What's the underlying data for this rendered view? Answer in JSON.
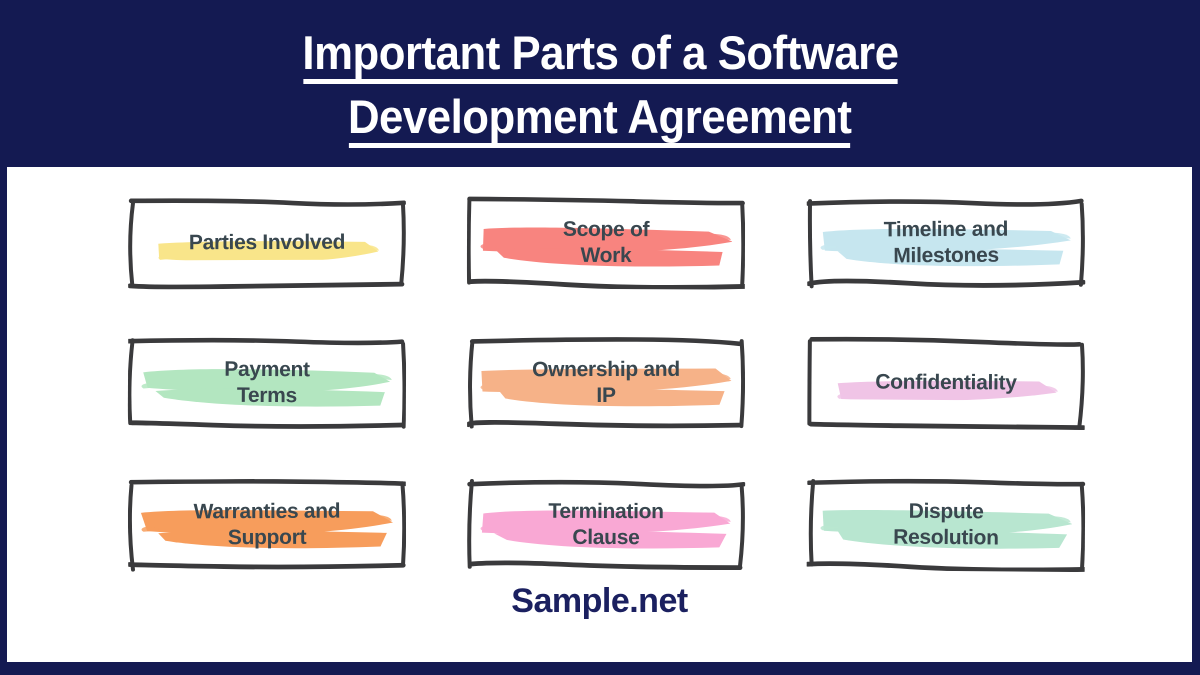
{
  "header": {
    "title_line_1": "Important Parts of a Software",
    "title_line_2": "Development Agreement",
    "background_color": "#141a52",
    "text_color": "#ffffff"
  },
  "canvas": {
    "background_color": "#ffffff"
  },
  "cards": [
    {
      "label": "Parties Involved",
      "highlight_color": "#f9e58a",
      "row": 1,
      "col": 1,
      "lines": 1
    },
    {
      "label": "Scope of\nWork",
      "highlight_color": "#f8847f",
      "row": 1,
      "col": 2,
      "lines": 2
    },
    {
      "label": "Timeline and\nMilestones",
      "highlight_color": "#c6e6ef",
      "row": 1,
      "col": 3,
      "lines": 2
    },
    {
      "label": "Payment\nTerms",
      "highlight_color": "#b3e6c0",
      "row": 2,
      "col": 1,
      "lines": 2
    },
    {
      "label": "Ownership and\nIP",
      "highlight_color": "#f6b288",
      "row": 2,
      "col": 2,
      "lines": 2
    },
    {
      "label": "Confidentiality",
      "highlight_color": "#f0c4e6",
      "row": 2,
      "col": 3,
      "lines": 1
    },
    {
      "label": "Warranties and\nSupport",
      "highlight_color": "#f79d5c",
      "row": 3,
      "col": 1,
      "lines": 2
    },
    {
      "label": "Termination\nClause",
      "highlight_color": "#f9a8d4",
      "row": 3,
      "col": 2,
      "lines": 2
    },
    {
      "label": "Dispute\nResolution",
      "highlight_color": "#b8e6d0",
      "row": 3,
      "col": 3,
      "lines": 2
    }
  ],
  "card_style": {
    "text_color": "#39474f",
    "border_color": "#3a3a3c"
  },
  "footer": {
    "brand": "Sample.net",
    "color": "#1b2060"
  }
}
